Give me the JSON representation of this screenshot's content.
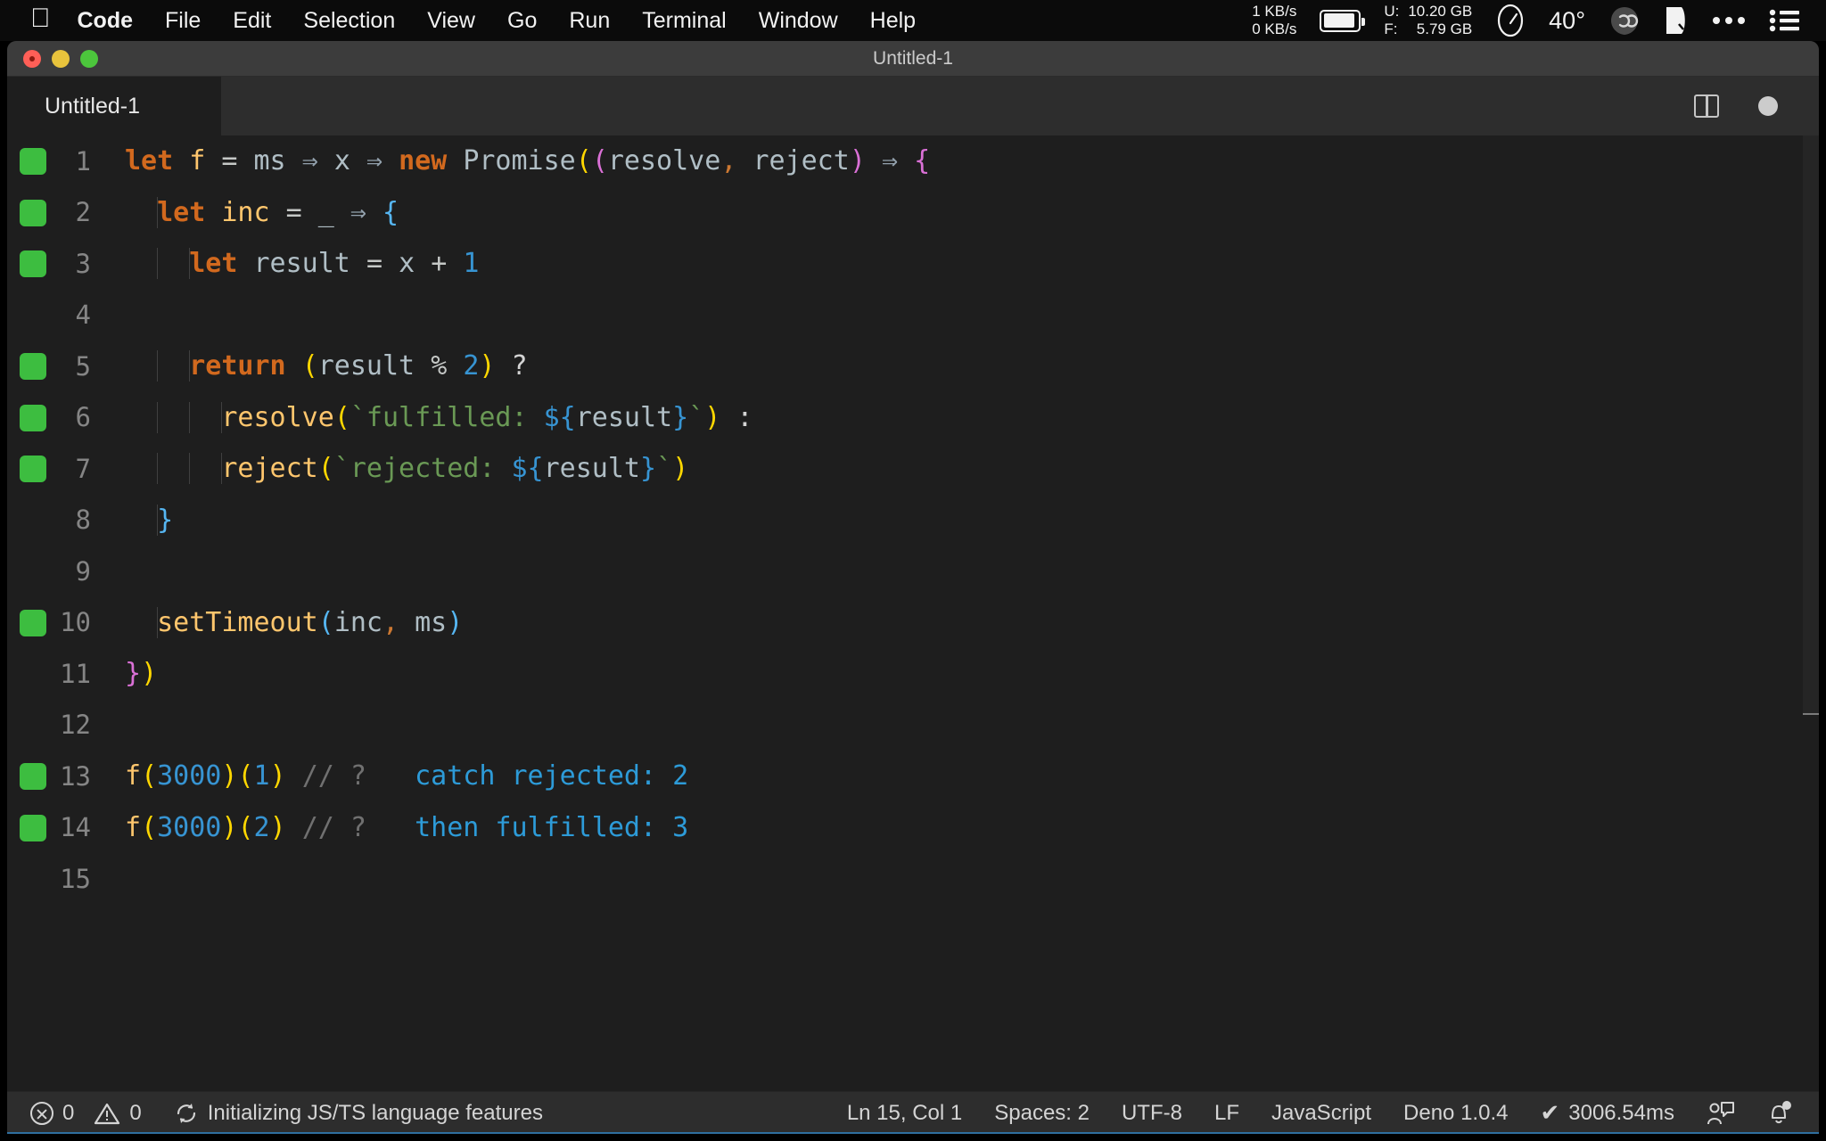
{
  "menubar": {
    "apple_glyph": "apple-logo",
    "items": [
      {
        "label": "Code",
        "bold": true
      },
      {
        "label": "File"
      },
      {
        "label": "Edit"
      },
      {
        "label": "Selection"
      },
      {
        "label": "View"
      },
      {
        "label": "Go"
      },
      {
        "label": "Run"
      },
      {
        "label": "Terminal"
      },
      {
        "label": "Window"
      },
      {
        "label": "Help"
      }
    ],
    "status": {
      "net_up": "1 KB/s",
      "net_down": "0 KB/s",
      "battery_icon": "battery-icon",
      "mem_used_key": "U:",
      "mem_used_val": "10.20 GB",
      "mem_free_key": "F:",
      "mem_free_val": "5.79 GB",
      "gauge_icon": "gauge-icon",
      "temperature": "40°",
      "cloud_icon": "cloud-sync-icon",
      "shield_icon": "shield-icon",
      "more_icon": "ellipsis-icon",
      "list_icon": "control-center-icon"
    }
  },
  "window": {
    "title": "Untitled-1",
    "traffic_lights": [
      "close-button",
      "minimize-button",
      "maximize-button"
    ]
  },
  "tabs": {
    "items": [
      {
        "label": "Untitled-1",
        "active": true,
        "dirty": true
      }
    ],
    "actions": {
      "split_icon": "split-editor-icon",
      "dirty_dot": "unsaved-indicator"
    }
  },
  "editor": {
    "language": "JavaScript",
    "lines": [
      {
        "n": "1",
        "cov": true,
        "indent": 0,
        "tokens": [
          {
            "t": "let",
            "c": "t-kw"
          },
          {
            "t": " ",
            "c": "t-plain"
          },
          {
            "t": "f",
            "c": "t-fn"
          },
          {
            "t": " ",
            "c": "t-plain"
          },
          {
            "t": "=",
            "c": "t-op"
          },
          {
            "t": " ",
            "c": "t-plain"
          },
          {
            "t": "ms",
            "c": "t-var"
          },
          {
            "t": " ",
            "c": "t-plain"
          },
          {
            "t": "⇒",
            "c": "t-arrow"
          },
          {
            "t": " ",
            "c": "t-plain"
          },
          {
            "t": "x",
            "c": "t-var"
          },
          {
            "t": " ",
            "c": "t-plain"
          },
          {
            "t": "⇒",
            "c": "t-arrow"
          },
          {
            "t": " ",
            "c": "t-plain"
          },
          {
            "t": "new",
            "c": "t-kw"
          },
          {
            "t": " ",
            "c": "t-plain"
          },
          {
            "t": "Promise",
            "c": "t-var"
          },
          {
            "t": "(",
            "c": "b-yellow"
          },
          {
            "t": "(",
            "c": "b-pink"
          },
          {
            "t": "resolve",
            "c": "t-var"
          },
          {
            "t": ",",
            "c": "t-comma"
          },
          {
            "t": " ",
            "c": "t-plain"
          },
          {
            "t": "reject",
            "c": "t-var"
          },
          {
            "t": ")",
            "c": "b-pink"
          },
          {
            "t": " ",
            "c": "t-plain"
          },
          {
            "t": "⇒",
            "c": "t-arrow"
          },
          {
            "t": " ",
            "c": "t-plain"
          },
          {
            "t": "{",
            "c": "b-pink"
          }
        ]
      },
      {
        "n": "2",
        "cov": true,
        "indent": 1,
        "tokens": [
          {
            "t": "  ",
            "c": "t-plain"
          },
          {
            "t": "let",
            "c": "t-kw"
          },
          {
            "t": " ",
            "c": "t-plain"
          },
          {
            "t": "inc",
            "c": "t-fn"
          },
          {
            "t": " ",
            "c": "t-plain"
          },
          {
            "t": "=",
            "c": "t-op"
          },
          {
            "t": " ",
            "c": "t-plain"
          },
          {
            "t": "_",
            "c": "t-var"
          },
          {
            "t": " ",
            "c": "t-plain"
          },
          {
            "t": "⇒",
            "c": "t-arrow"
          },
          {
            "t": " ",
            "c": "t-plain"
          },
          {
            "t": "{",
            "c": "b-blue"
          }
        ]
      },
      {
        "n": "3",
        "cov": true,
        "indent": 2,
        "tokens": [
          {
            "t": "    ",
            "c": "t-plain"
          },
          {
            "t": "let",
            "c": "t-kw"
          },
          {
            "t": " ",
            "c": "t-plain"
          },
          {
            "t": "result",
            "c": "t-var"
          },
          {
            "t": " ",
            "c": "t-plain"
          },
          {
            "t": "=",
            "c": "t-op"
          },
          {
            "t": " ",
            "c": "t-plain"
          },
          {
            "t": "x",
            "c": "t-var"
          },
          {
            "t": " ",
            "c": "t-plain"
          },
          {
            "t": "+",
            "c": "t-op"
          },
          {
            "t": " ",
            "c": "t-plain"
          },
          {
            "t": "1",
            "c": "t-num"
          }
        ]
      },
      {
        "n": "4",
        "cov": false,
        "indent": 2,
        "tokens": []
      },
      {
        "n": "5",
        "cov": true,
        "indent": 2,
        "tokens": [
          {
            "t": "    ",
            "c": "t-plain"
          },
          {
            "t": "return",
            "c": "t-kw"
          },
          {
            "t": " ",
            "c": "t-plain"
          },
          {
            "t": "(",
            "c": "b-yellow"
          },
          {
            "t": "result",
            "c": "t-var"
          },
          {
            "t": " ",
            "c": "t-plain"
          },
          {
            "t": "%",
            "c": "t-op"
          },
          {
            "t": " ",
            "c": "t-plain"
          },
          {
            "t": "2",
            "c": "t-num"
          },
          {
            "t": ")",
            "c": "b-yellow"
          },
          {
            "t": " ",
            "c": "t-plain"
          },
          {
            "t": "?",
            "c": "t-plain"
          }
        ]
      },
      {
        "n": "6",
        "cov": true,
        "indent": 3,
        "tokens": [
          {
            "t": "      ",
            "c": "t-plain"
          },
          {
            "t": "resolve",
            "c": "t-fn"
          },
          {
            "t": "(",
            "c": "b-yellow"
          },
          {
            "t": "`fulfilled: ",
            "c": "t-str"
          },
          {
            "t": "${",
            "c": "t-tmpl"
          },
          {
            "t": "result",
            "c": "t-var"
          },
          {
            "t": "}",
            "c": "t-tmpl"
          },
          {
            "t": "`",
            "c": "t-str"
          },
          {
            "t": ")",
            "c": "b-yellow"
          },
          {
            "t": " ",
            "c": "t-plain"
          },
          {
            "t": ":",
            "c": "t-plain"
          }
        ]
      },
      {
        "n": "7",
        "cov": true,
        "indent": 3,
        "tokens": [
          {
            "t": "      ",
            "c": "t-plain"
          },
          {
            "t": "reject",
            "c": "t-fn"
          },
          {
            "t": "(",
            "c": "b-yellow"
          },
          {
            "t": "`rejected: ",
            "c": "t-str"
          },
          {
            "t": "${",
            "c": "t-tmpl"
          },
          {
            "t": "result",
            "c": "t-var"
          },
          {
            "t": "}",
            "c": "t-tmpl"
          },
          {
            "t": "`",
            "c": "t-str"
          },
          {
            "t": ")",
            "c": "b-yellow"
          }
        ]
      },
      {
        "n": "8",
        "cov": false,
        "indent": 1,
        "tokens": [
          {
            "t": "  ",
            "c": "t-plain"
          },
          {
            "t": "}",
            "c": "b-blue"
          }
        ]
      },
      {
        "n": "9",
        "cov": false,
        "indent": 1,
        "tokens": []
      },
      {
        "n": "10",
        "cov": true,
        "indent": 1,
        "tokens": [
          {
            "t": "  ",
            "c": "t-plain"
          },
          {
            "t": "setTimeout",
            "c": "t-fn"
          },
          {
            "t": "(",
            "c": "b-blue"
          },
          {
            "t": "inc",
            "c": "t-var"
          },
          {
            "t": ",",
            "c": "t-comma"
          },
          {
            "t": " ",
            "c": "t-plain"
          },
          {
            "t": "ms",
            "c": "t-var"
          },
          {
            "t": ")",
            "c": "b-blue"
          }
        ]
      },
      {
        "n": "11",
        "cov": false,
        "indent": 0,
        "tokens": [
          {
            "t": "}",
            "c": "b-pink"
          },
          {
            "t": ")",
            "c": "b-yellow"
          }
        ]
      },
      {
        "n": "12",
        "cov": false,
        "indent": 0,
        "tokens": []
      },
      {
        "n": "13",
        "cov": true,
        "indent": 0,
        "tokens": [
          {
            "t": "f",
            "c": "t-fn"
          },
          {
            "t": "(",
            "c": "b-yellow"
          },
          {
            "t": "3000",
            "c": "t-num"
          },
          {
            "t": ")",
            "c": "b-yellow"
          },
          {
            "t": "(",
            "c": "b-yellow"
          },
          {
            "t": "1",
            "c": "t-num"
          },
          {
            "t": ")",
            "c": "b-yellow"
          },
          {
            "t": " ",
            "c": "t-plain"
          },
          {
            "t": "// ?",
            "c": "t-comment"
          },
          {
            "t": "   ",
            "c": "t-plain"
          },
          {
            "t": "catch rejected: 2",
            "c": "t-inline"
          }
        ]
      },
      {
        "n": "14",
        "cov": true,
        "indent": 0,
        "tokens": [
          {
            "t": "f",
            "c": "t-fn"
          },
          {
            "t": "(",
            "c": "b-yellow"
          },
          {
            "t": "3000",
            "c": "t-num"
          },
          {
            "t": ")",
            "c": "b-yellow"
          },
          {
            "t": "(",
            "c": "b-yellow"
          },
          {
            "t": "2",
            "c": "t-num"
          },
          {
            "t": ")",
            "c": "b-yellow"
          },
          {
            "t": " ",
            "c": "t-plain"
          },
          {
            "t": "// ?",
            "c": "t-comment"
          },
          {
            "t": "   ",
            "c": "t-plain"
          },
          {
            "t": "then fulfilled: 3",
            "c": "t-inline"
          }
        ]
      },
      {
        "n": "15",
        "cov": false,
        "indent": 0,
        "current": true,
        "tokens": []
      }
    ]
  },
  "statusbar": {
    "errors_icon": "error-icon",
    "errors": "0",
    "warnings_icon": "warning-icon",
    "warnings": "0",
    "sync_icon": "sync-icon",
    "task": "Initializing JS/TS language features",
    "cursor": "Ln 15, Col 1",
    "indentation": "Spaces: 2",
    "encoding": "UTF-8",
    "eol": "LF",
    "language": "JavaScript",
    "runtime": "Deno 1.0.4",
    "check_icon": "check-icon",
    "duration": "3006.54ms",
    "feedback_icon": "feedback-icon",
    "bell_icon": "notifications-bell-icon"
  },
  "colors": {
    "editor_bg": "#1e1e1e",
    "titlebar_bg": "#3c3c3c",
    "tabbar_bg": "#2d2d2d",
    "statusbar_bg": "#2d2d2d",
    "coverage_green": "#3dbd40",
    "accent_blue": "#2d9bd8"
  }
}
